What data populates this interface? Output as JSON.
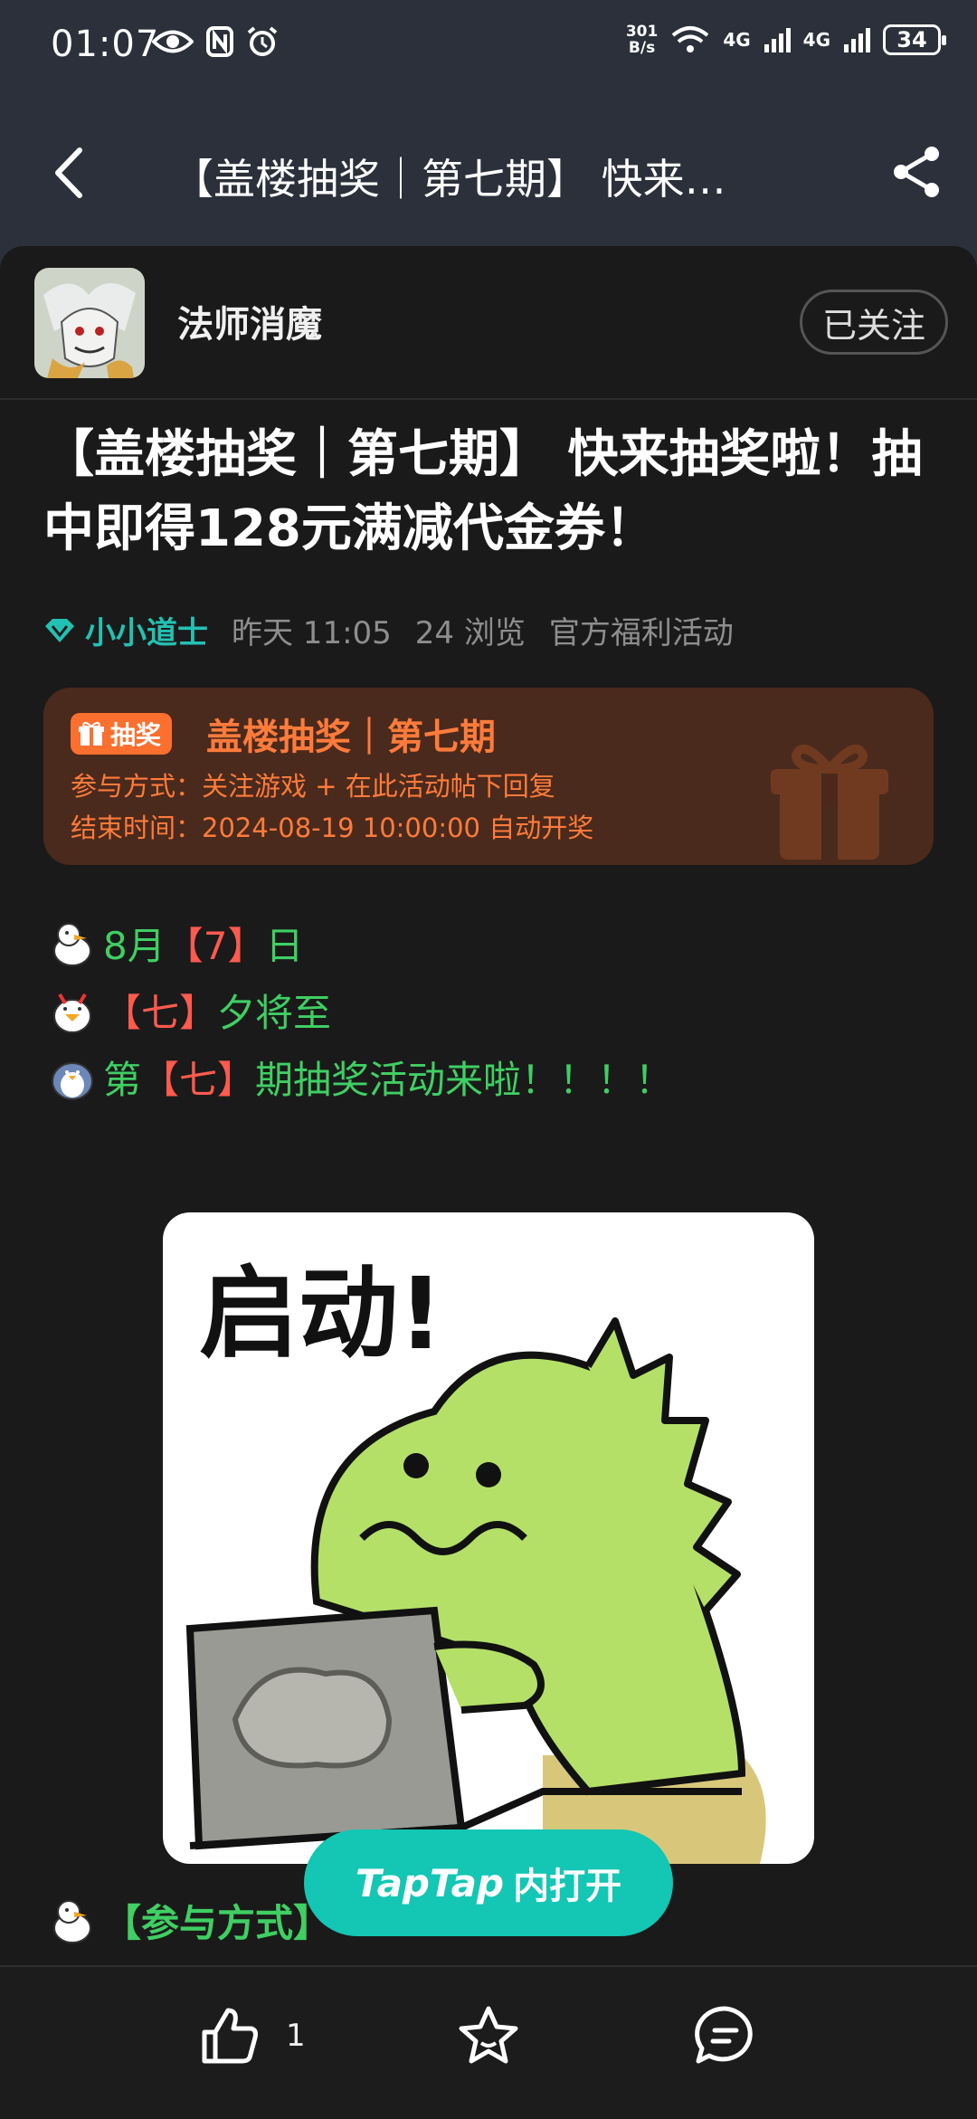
{
  "status_bar": {
    "time": "01:07",
    "net_speed_top": "301",
    "net_speed_bottom": "B/s",
    "signal1": "4G",
    "signal2": "4G",
    "battery": "34"
  },
  "nav": {
    "title": "【盖楼抽奖｜第七期】 快来…"
  },
  "author": {
    "name": "法师消魔",
    "follow_label": "已关注"
  },
  "post": {
    "title": "【盖楼抽奖｜第七期】 快来抽奖啦！抽中即得128元满减代金券！",
    "user": "小小道士",
    "time": "昨天 11:05",
    "views": "24 浏览",
    "category": "官方福利活动"
  },
  "lottery": {
    "badge": "抽奖",
    "title": "盖楼抽奖｜第七期",
    "join_method": "参与方式：关注游戏 + 在此活动帖下回复",
    "end_time": "结束时间：2024-08-19 10:00:00 自动开奖"
  },
  "body": {
    "line1_a": "8月",
    "line1_b": "【7】",
    "line1_c": "日",
    "line2_b": "【七】",
    "line2_c": "夕将至",
    "line3_a": "第",
    "line3_b": "【七】",
    "line3_c": "期抽奖活动来啦！！！！",
    "sticker_text": "启动!",
    "section_head": "【参与方式】"
  },
  "open_button": {
    "brand": "TapTap",
    "label": "内打开"
  },
  "bottom_bar": {
    "like_count": "1"
  }
}
